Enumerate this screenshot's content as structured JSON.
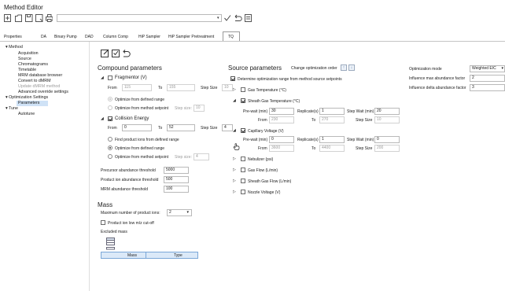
{
  "window": {
    "title": "Method Editor"
  },
  "toolbar": {
    "combo_value": ""
  },
  "tabs": [
    {
      "label": "Properties"
    },
    {
      "label": "DA"
    },
    {
      "label": "Binary Pump"
    },
    {
      "label": "DAD"
    },
    {
      "label": "Column Comp"
    },
    {
      "label": "HiP Sampler"
    },
    {
      "label": "HiP Sampler Pretreatment"
    },
    {
      "label": "TQ"
    }
  ],
  "active_tab": "TQ",
  "tree": {
    "method": "Method",
    "method_items": [
      "Acquisition",
      "Source",
      "Chromatograms",
      "Timetable",
      "MRM database browser",
      "Convert to dMRM",
      "Update dMRM method",
      "Advanced override settings"
    ],
    "opt": "Optimization Settings",
    "opt_items": [
      "Parameters"
    ],
    "tune": "Tune",
    "tune_items": [
      "Autotune"
    ]
  },
  "compound": {
    "title": "Compound parameters",
    "fragmentor": {
      "label": "Fragmentor (V)",
      "checked": false,
      "from_label": "From",
      "from": "115",
      "to_label": "To",
      "to": "155",
      "step_label": "Step Size",
      "step": "10",
      "opt_range": "Optimize from defined range",
      "opt_setpoint": "Optimize from method setpoint",
      "step_size_label": "Step size:",
      "step_size": "10"
    },
    "collision": {
      "label": "Collision Energy",
      "checked": true,
      "from_label": "From",
      "from": "0",
      "to_label": "To",
      "to": "52",
      "step_label": "Step Size",
      "step": "4",
      "find_product": "Find product ions from defined range",
      "opt_range": "Optimize from defined range",
      "opt_setpoint": "Optimize from method setpoint",
      "step_size_label": "Step size:",
      "step_size": "4"
    },
    "thresholds": [
      {
        "label": "Precursor abundance threshold",
        "value": "5000"
      },
      {
        "label": "Product ion abundance threshold",
        "value": "500"
      },
      {
        "label": "MRM abundance threshold",
        "value": "100"
      }
    ]
  },
  "mass": {
    "title": "Mass",
    "max_label": "Maximum number of product ions:",
    "max_value": "2",
    "cutoff_label": "Product ion low m/z cut-off",
    "excluded_label": "Excluded mass",
    "col_mass": "Mass",
    "col_type": "Type"
  },
  "source": {
    "title": "Source parameters",
    "order_label": "Change optimization order",
    "determine_label": "Determine optimization range from method source setpoints",
    "gas_temp": "Gas Temperature (°C)",
    "sheath_temp": {
      "label": "Sheath Gas Temperature (°C)",
      "prewait_label": "Pre-wait (min)",
      "prewait": "30",
      "repl_label": "Replicate(s)",
      "repl": "1",
      "stepwait_label": "Step Wait (min)",
      "stepwait": "20",
      "from_label": "From",
      "from": "230",
      "to_label": "To",
      "to": "270",
      "step_label": "Step Size",
      "step": "10"
    },
    "cap_voltage": {
      "label": "Capillary Voltage (V)",
      "prewait_label": "Pre-wait (min)",
      "prewait": "0",
      "repl_label": "Replicate(s)",
      "repl": "1",
      "stepwait_label": "Step Wait (min)",
      "stepwait": "0",
      "from_label": "From",
      "from": "3600",
      "to_label": "To",
      "to": "4400",
      "step_label": "Step Size",
      "step": "200"
    },
    "others": [
      "Nebulizer (psi)",
      "Gas Flow (L/min)",
      "Sheath Gas Flow (L/min)",
      "Nozzle Voltage (V)"
    ]
  },
  "options": {
    "mode_label": "Optimization mode",
    "mode_value": "Weighted EIC",
    "inf_max_label": "Influence max abundance factor",
    "inf_max": "2",
    "inf_delta_label": "Influence delta abundance factor",
    "inf_delta": "3"
  }
}
